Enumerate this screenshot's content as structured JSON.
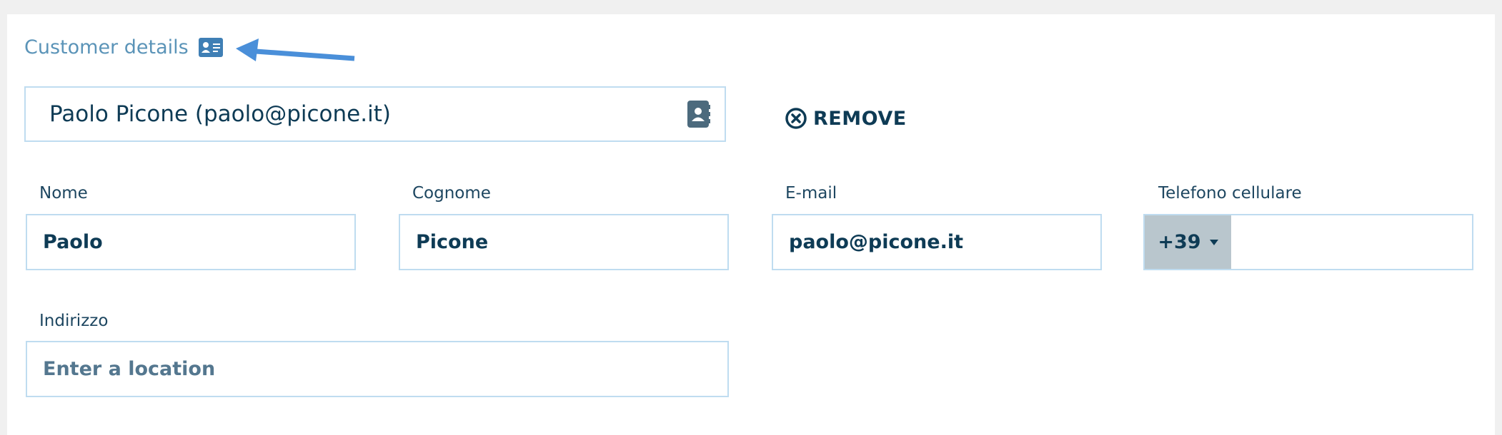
{
  "section": {
    "title": "Customer details"
  },
  "customer_select": {
    "value": "Paolo Picone (paolo@picone.it)"
  },
  "remove_button": {
    "label": "REMOVE"
  },
  "fields": {
    "first_name": {
      "label": "Nome",
      "value": "Paolo"
    },
    "last_name": {
      "label": "Cognome",
      "value": "Picone"
    },
    "email": {
      "label": "E-mail",
      "value": "paolo@picone.it"
    },
    "mobile": {
      "label": "Telefono cellulare",
      "country_code": "+39",
      "value": ""
    },
    "address": {
      "label": "Indirizzo",
      "placeholder": "Enter a location",
      "value": ""
    }
  },
  "icons": {
    "title_icon": "id-card-icon",
    "select_icon": "contact-book-icon",
    "remove_icon": "circle-x-icon",
    "caret_icon": "caret-down-icon",
    "annotation": "pointer-arrow"
  },
  "colors": {
    "background": "#f0f0f0",
    "panel": "#ffffff",
    "title": "#5b94b8",
    "text_dark": "#0e3b55",
    "input_border": "#bfdcf0",
    "country_code_bg": "#b9c6cd",
    "annotation_arrow": "#4a8fd9",
    "icon_blue": "#3f7fb5",
    "icon_slate": "#4c6a7d"
  }
}
